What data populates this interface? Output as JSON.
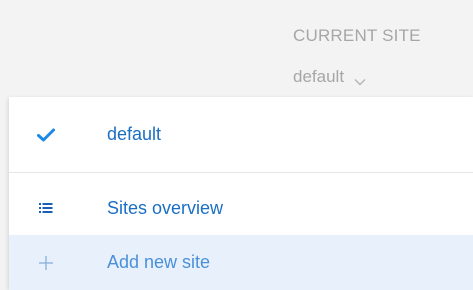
{
  "header": {
    "label": "CURRENT SITE",
    "value": "default"
  },
  "menu": {
    "items": [
      {
        "label": "default",
        "icon": "checkmark-icon",
        "selected": true
      },
      {
        "label": "Sites overview",
        "icon": "list-icon"
      },
      {
        "label": "Add new site",
        "icon": "plus-icon"
      }
    ]
  },
  "colors": {
    "accent": "#1a6fc4",
    "check": "#1e88e5",
    "muted_text": "#a6a6a6",
    "highlight_bg": "#e8f1fb"
  }
}
